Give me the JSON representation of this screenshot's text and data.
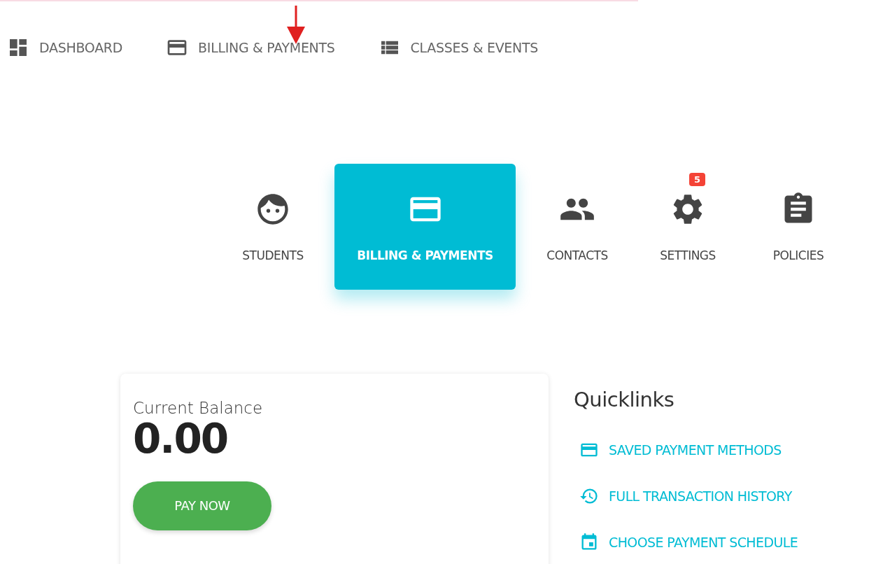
{
  "top_nav": [
    {
      "label": "DASHBOARD"
    },
    {
      "label": "BILLING & PAYMENTS"
    },
    {
      "label": "CLASSES & EVENTS"
    }
  ],
  "tiles": [
    {
      "label": "STUDENTS",
      "selected": false
    },
    {
      "label": "BILLING & PAYMENTS",
      "selected": true
    },
    {
      "label": "CONTACTS",
      "selected": false
    },
    {
      "label": "SETTINGS",
      "selected": false,
      "badge": "5"
    },
    {
      "label": "POLICIES",
      "selected": false
    }
  ],
  "balance_card": {
    "label": "Current Balance",
    "amount": "0.00",
    "button": "PAY NOW"
  },
  "quicklinks": {
    "title": "Quicklinks",
    "links": [
      {
        "label": "SAVED PAYMENT METHODS"
      },
      {
        "label": "FULL TRANSACTION HISTORY"
      },
      {
        "label": "CHOOSE PAYMENT SCHEDULE"
      }
    ]
  }
}
